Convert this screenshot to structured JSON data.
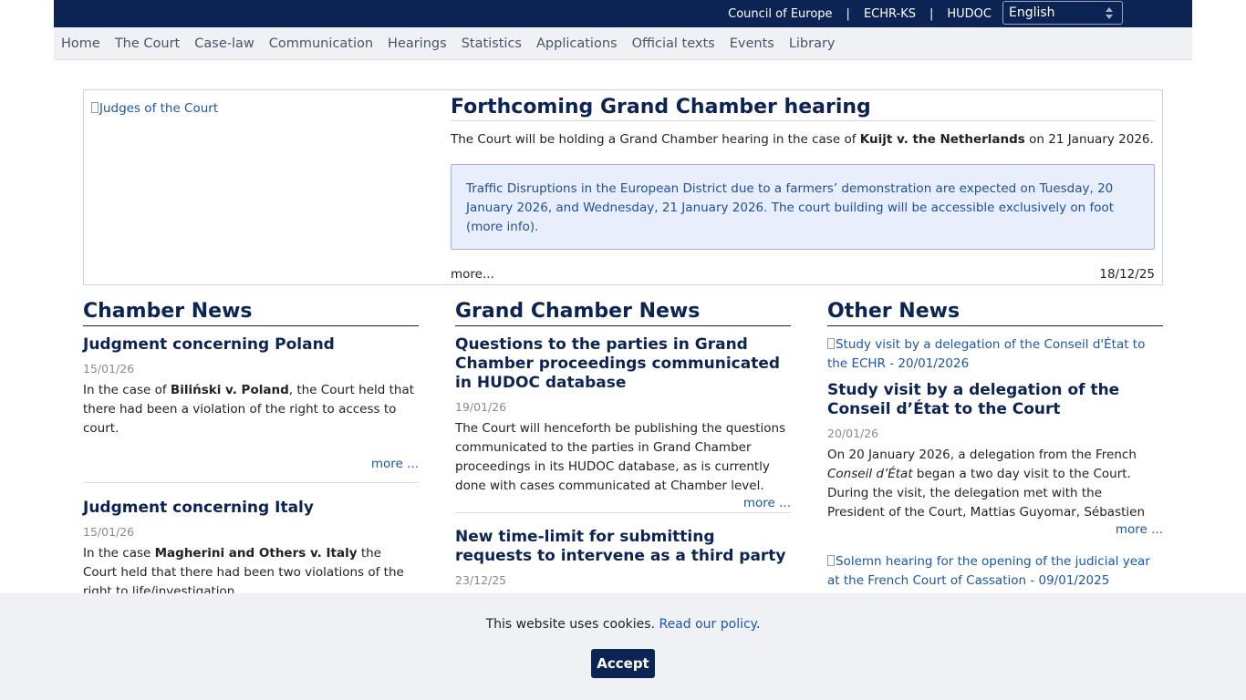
{
  "topbar": {
    "links": [
      "Council of Europe",
      "ECHR-KS",
      "HUDOC"
    ],
    "separator": "|",
    "language": "English"
  },
  "nav": [
    "Home",
    "The Court",
    "Case-law",
    "Communication",
    "Hearings",
    "Statistics",
    "Applications",
    "Official texts",
    "Events",
    "Library"
  ],
  "hero": {
    "image_alt": "Judges of the Court",
    "title": "Forthcoming Grand Chamber hearing",
    "lead_before": "The Court will be holding a Grand Chamber hearing in the case of ",
    "lead_case": "Kuijt v. the Netherlands",
    "lead_after": " on 21 January 2026.",
    "notice": "Traffic Disruptions in the European District due to a farmers’ demonstration are expected on Tuesday, 20 January 2026, and Wednesday, 21 January 2026. The court building will be accessible exclusively on foot (more info).",
    "more": "more...",
    "date": "18/12/25"
  },
  "chamber": {
    "heading": "Chamber News",
    "a1": {
      "title": "Judgment concerning Poland",
      "date": "15/01/26",
      "text_before": "In the case of ",
      "case": "Biliński v. Poland",
      "text_after": ", the Court held that there had been a violation of the right to access to court.",
      "more": "more ..."
    },
    "a2": {
      "title": "Judgment concerning Italy",
      "date": "15/01/26",
      "text_before": "In the case ",
      "case": "Magherini and Others v. Italy",
      "text_after": " the Court held that there had been two violations of the right to life/investigation."
    }
  },
  "grand": {
    "heading": "Grand Chamber News",
    "a1": {
      "title": "Questions to the parties in Grand Chamber proceedings communicated in HUDOC database",
      "date": "19/01/26",
      "text": "The Court will henceforth be publishing the questions communicated to the parties in Grand Chamber proceedings in its HUDOC database, as is currently done with cases communicated at Chamber level. These",
      "more": "more ..."
    },
    "a2": {
      "title": "New time-limit for submitting requests to intervene as a third party",
      "date": "23/12/25"
    }
  },
  "other": {
    "heading": "Other News",
    "a1": {
      "image_alt": "Study visit by a delegation of the Conseil d'État to the ECHR - 20/01/2026",
      "title": "Study visit by a delegation of the Conseil d’État to the Court",
      "date": "20/01/26",
      "text_before": "On 20 January 2026, a delegation from the French ",
      "text_em": "Conseil d’État",
      "text_after": " began a two day visit to the Court. During the visit, the delegation met with the President of the Court, Mattias Guyomar, Sébastien Biancheri,",
      "more": "more ..."
    },
    "a2": {
      "image_alt": "Solemn hearing for the opening of the judicial year at the French Court of Cassation - 09/01/2025"
    }
  },
  "cookie": {
    "text": "This website uses cookies. ",
    "link": "Read our policy",
    "end": ".",
    "accept": "Accept"
  }
}
